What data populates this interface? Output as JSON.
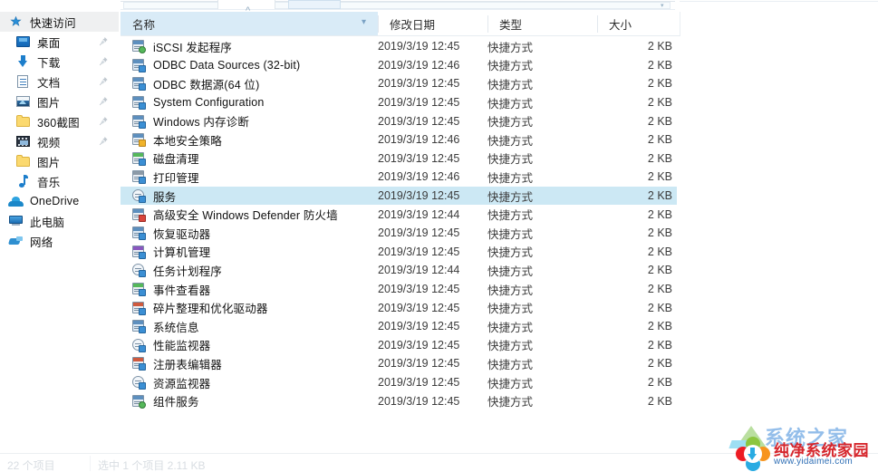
{
  "window": {
    "accent_selection_color": "#cce8f4",
    "column_header_highlight_color": "#d9ebf7"
  },
  "sidebar": {
    "items": [
      {
        "label": "快速访问",
        "icon": "star-pin-icon",
        "pinned": false,
        "header": true,
        "indent": false
      },
      {
        "label": "桌面",
        "icon": "desktop-icon",
        "pinned": true,
        "header": false,
        "indent": true
      },
      {
        "label": "下载",
        "icon": "download-icon",
        "pinned": true,
        "header": false,
        "indent": true
      },
      {
        "label": "文档",
        "icon": "document-icon",
        "pinned": true,
        "header": false,
        "indent": true
      },
      {
        "label": "图片",
        "icon": "pictures-icon",
        "pinned": true,
        "header": false,
        "indent": true
      },
      {
        "label": "360截图",
        "icon": "folder-icon",
        "pinned": true,
        "header": false,
        "indent": true
      },
      {
        "label": "视频",
        "icon": "video-icon",
        "pinned": true,
        "header": false,
        "indent": true
      },
      {
        "label": "图片",
        "icon": "folder-icon",
        "pinned": false,
        "header": false,
        "indent": true
      },
      {
        "label": "音乐",
        "icon": "music-icon",
        "pinned": false,
        "header": false,
        "indent": true
      },
      {
        "label": "OneDrive",
        "icon": "onedrive-cloud-icon",
        "pinned": false,
        "header": false,
        "indent": false
      },
      {
        "label": "此电脑",
        "icon": "this-pc-icon",
        "pinned": false,
        "header": false,
        "indent": false
      },
      {
        "label": "网络",
        "icon": "network-icon",
        "pinned": false,
        "header": false,
        "indent": false
      }
    ]
  },
  "file_list": {
    "columns": [
      {
        "key": "name",
        "label": "名称",
        "sorted": true,
        "sort_direction": "ascending"
      },
      {
        "key": "date",
        "label": "修改日期",
        "sorted": false,
        "sort_direction": ""
      },
      {
        "key": "type",
        "label": "类型",
        "sorted": false,
        "sort_direction": ""
      },
      {
        "key": "size",
        "label": "大小",
        "sorted": false,
        "sort_direction": ""
      }
    ],
    "rows": [
      {
        "name": "iSCSI 发起程序",
        "date": "2019/3/19 12:45",
        "type": "快捷方式",
        "size": "2 KB",
        "selected": false,
        "icon": "shortcut-green-icon"
      },
      {
        "name": "ODBC Data Sources (32-bit)",
        "date": "2019/3/19 12:46",
        "type": "快捷方式",
        "size": "2 KB",
        "selected": false,
        "icon": "shortcut-odbc-icon"
      },
      {
        "name": "ODBC 数据源(64 位)",
        "date": "2019/3/19 12:45",
        "type": "快捷方式",
        "size": "2 KB",
        "selected": false,
        "icon": "shortcut-odbc-icon"
      },
      {
        "name": "System Configuration",
        "date": "2019/3/19 12:45",
        "type": "快捷方式",
        "size": "2 KB",
        "selected": false,
        "icon": "shortcut-config-icon"
      },
      {
        "name": "Windows 内存诊断",
        "date": "2019/3/19 12:45",
        "type": "快捷方式",
        "size": "2 KB",
        "selected": false,
        "icon": "shortcut-memory-icon"
      },
      {
        "name": "本地安全策略",
        "date": "2019/3/19 12:46",
        "type": "快捷方式",
        "size": "2 KB",
        "selected": false,
        "icon": "shortcut-security-icon"
      },
      {
        "name": "磁盘清理",
        "date": "2019/3/19 12:45",
        "type": "快捷方式",
        "size": "2 KB",
        "selected": false,
        "icon": "shortcut-cleanup-icon"
      },
      {
        "name": "打印管理",
        "date": "2019/3/19 12:46",
        "type": "快捷方式",
        "size": "2 KB",
        "selected": false,
        "icon": "shortcut-print-icon"
      },
      {
        "name": "服务",
        "date": "2019/3/19 12:45",
        "type": "快捷方式",
        "size": "2 KB",
        "selected": true,
        "icon": "shortcut-services-icon"
      },
      {
        "name": "高级安全 Windows Defender 防火墙",
        "date": "2019/3/19 12:44",
        "type": "快捷方式",
        "size": "2 KB",
        "selected": false,
        "icon": "shortcut-firewall-icon"
      },
      {
        "name": "恢复驱动器",
        "date": "2019/3/19 12:45",
        "type": "快捷方式",
        "size": "2 KB",
        "selected": false,
        "icon": "shortcut-recovery-icon"
      },
      {
        "name": "计算机管理",
        "date": "2019/3/19 12:45",
        "type": "快捷方式",
        "size": "2 KB",
        "selected": false,
        "icon": "shortcut-compmgmt-icon"
      },
      {
        "name": "任务计划程序",
        "date": "2019/3/19 12:44",
        "type": "快捷方式",
        "size": "2 KB",
        "selected": false,
        "icon": "shortcut-scheduler-icon"
      },
      {
        "name": "事件查看器",
        "date": "2019/3/19 12:45",
        "type": "快捷方式",
        "size": "2 KB",
        "selected": false,
        "icon": "shortcut-eventvwr-icon"
      },
      {
        "name": "碎片整理和优化驱动器",
        "date": "2019/3/19 12:45",
        "type": "快捷方式",
        "size": "2 KB",
        "selected": false,
        "icon": "shortcut-defrag-icon"
      },
      {
        "name": "系统信息",
        "date": "2019/3/19 12:45",
        "type": "快捷方式",
        "size": "2 KB",
        "selected": false,
        "icon": "shortcut-sysinfo-icon"
      },
      {
        "name": "性能监视器",
        "date": "2019/3/19 12:45",
        "type": "快捷方式",
        "size": "2 KB",
        "selected": false,
        "icon": "shortcut-perfmon-icon"
      },
      {
        "name": "注册表编辑器",
        "date": "2019/3/19 12:45",
        "type": "快捷方式",
        "size": "2 KB",
        "selected": false,
        "icon": "shortcut-regedit-icon"
      },
      {
        "name": "资源监视器",
        "date": "2019/3/19 12:45",
        "type": "快捷方式",
        "size": "2 KB",
        "selected": false,
        "icon": "shortcut-resmon-icon"
      },
      {
        "name": "组件服务",
        "date": "2019/3/19 12:45",
        "type": "快捷方式",
        "size": "2 KB",
        "selected": false,
        "icon": "shortcut-dcomcnfg-icon"
      }
    ]
  },
  "status_bar": {
    "item_count_text": "22 个项目",
    "selection_text": "选中 1 个项目  2.11 KB"
  },
  "watermark": {
    "ghost_text": "系统之家",
    "site_name": "纯净系统家园",
    "site_url": "www.yidaimei.com"
  }
}
